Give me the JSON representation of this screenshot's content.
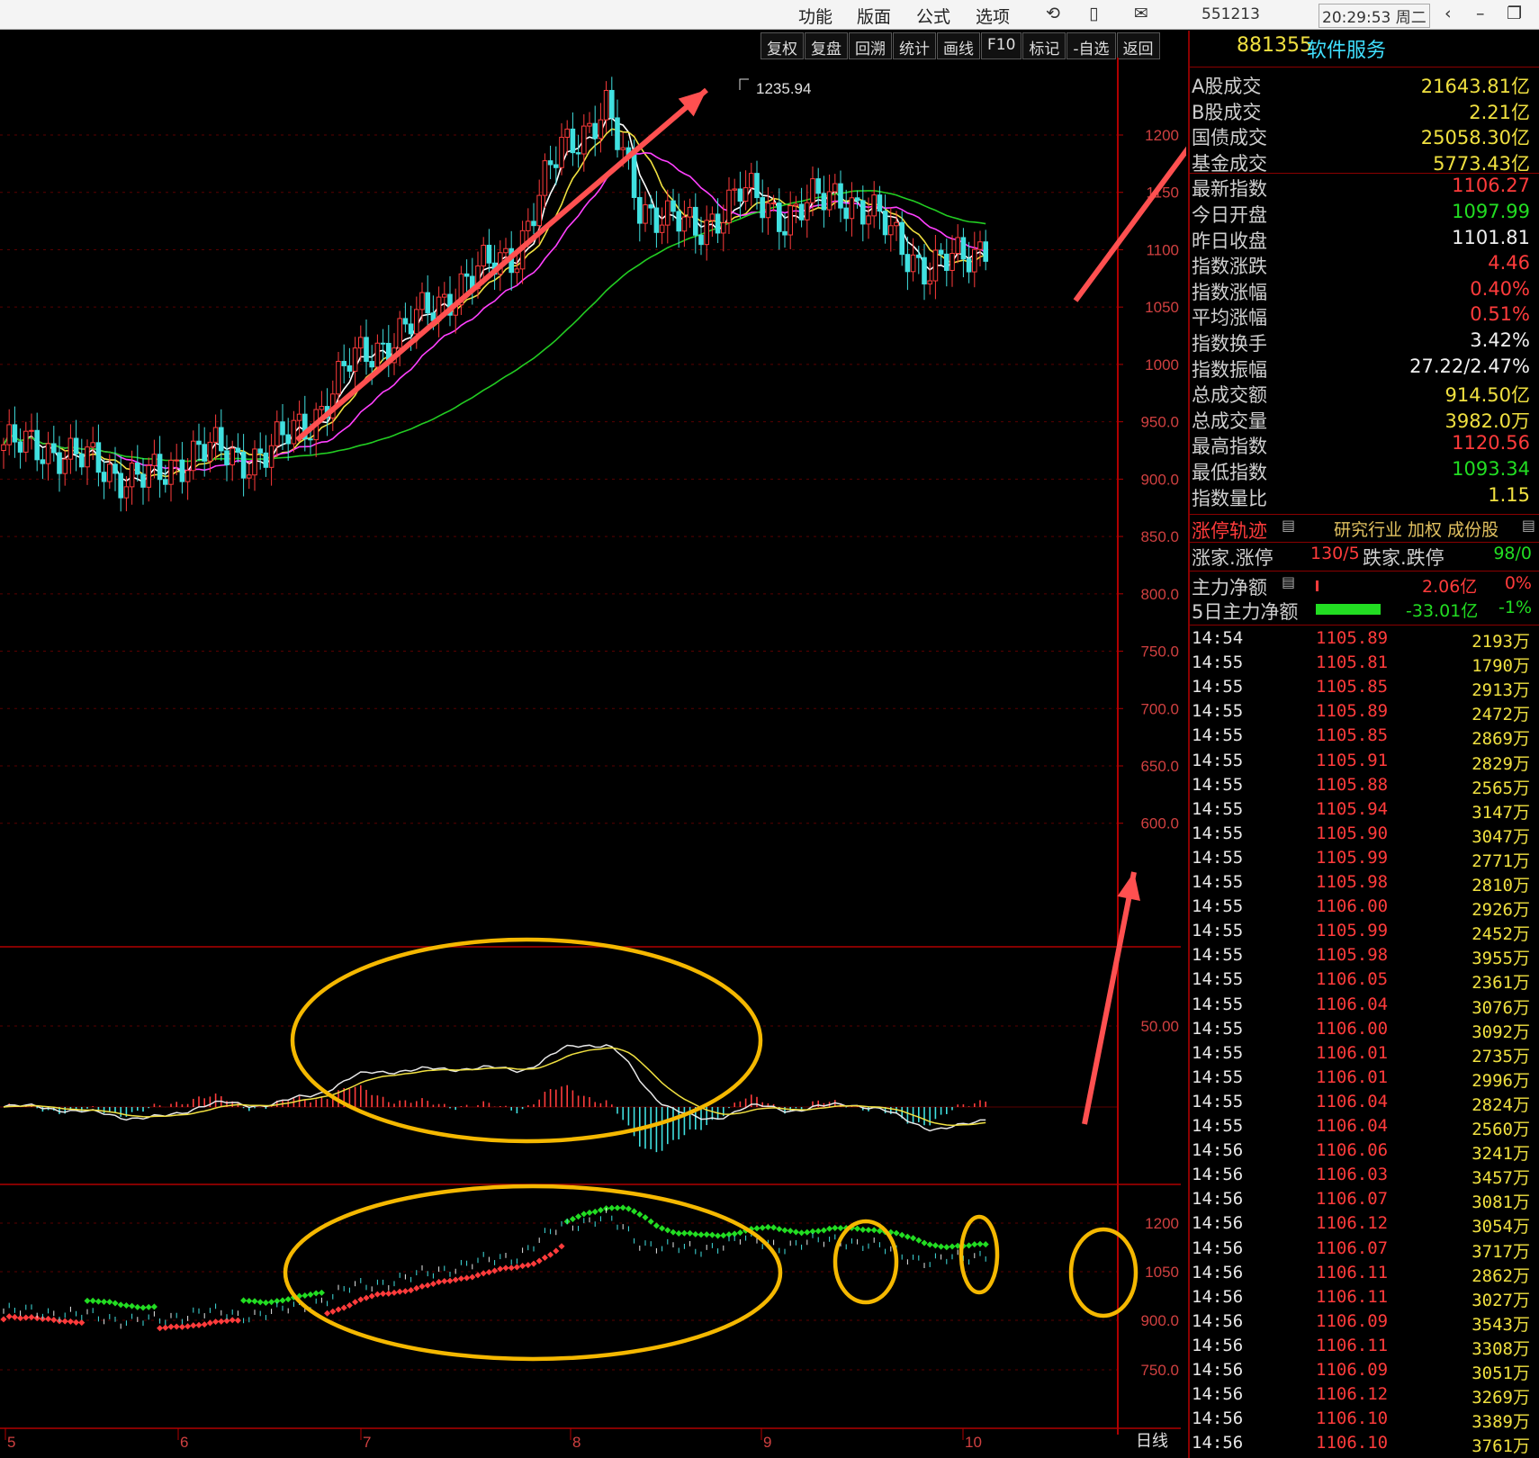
{
  "topbar": {
    "menus": [
      "功能",
      "版面",
      "公式",
      "选项"
    ],
    "code": "551213",
    "clock": "20:29:53 周二"
  },
  "chart_toolbar": [
    "复权",
    "复盘",
    "回溯",
    "统计",
    "画线",
    "F10",
    "标记",
    "-自选",
    "返回"
  ],
  "chart": {
    "peak_label": "1235.94",
    "price_axis": [
      "1200",
      "1150",
      "1100",
      "1050",
      "1000",
      "950.0",
      "900.0",
      "850.0",
      "800.0",
      "750.0",
      "700.0",
      "650.0",
      "600.0"
    ],
    "macd_axis": [
      "50.00"
    ],
    "lower_axis": [
      "1200",
      "1050",
      "900.0",
      "750.0"
    ],
    "x_labels": [
      "5",
      "6",
      "7",
      "8",
      "9",
      "10"
    ],
    "period": "日线",
    "colors": {
      "up": "#ff3b3b",
      "down": "#40e0e0",
      "ma5": "#ffffff",
      "ma10": "#f0e040",
      "ma20": "#ff40ff",
      "ma60": "#22cc22",
      "annot_arrow": "#ff5050",
      "annot_ellipse": "#f5b800"
    }
  },
  "side": {
    "title_code": "881355",
    "title_name": "软件服务",
    "stats": [
      {
        "label": "A股成交",
        "value": "21643.81亿",
        "color": "yellow"
      },
      {
        "label": "B股成交",
        "value": "2.21亿",
        "color": "yellow"
      },
      {
        "label": "国债成交",
        "value": "25058.30亿",
        "color": "yellow"
      },
      {
        "label": "基金成交",
        "value": "5773.43亿",
        "color": "yellow"
      },
      {
        "label": "最新指数",
        "value": "1106.27",
        "color": "red"
      },
      {
        "label": "今日开盘",
        "value": "1097.99",
        "color": "green"
      },
      {
        "label": "昨日收盘",
        "value": "1101.81",
        "color": "white"
      },
      {
        "label": "指数涨跌",
        "value": "4.46",
        "color": "red"
      },
      {
        "label": "指数涨幅",
        "value": "0.40%",
        "color": "red"
      },
      {
        "label": "平均涨幅",
        "value": "0.51%",
        "color": "red"
      },
      {
        "label": "指数换手",
        "value": "3.42%",
        "color": "white"
      },
      {
        "label": "指数振幅",
        "value": "27.22/2.47%",
        "color": "white"
      },
      {
        "label": "总成交额",
        "value": "914.50亿",
        "color": "yellow"
      },
      {
        "label": "总成交量",
        "value": "3982.0万",
        "color": "yellow"
      },
      {
        "label": "最高指数",
        "value": "1120.56",
        "color": "red"
      },
      {
        "label": "最低指数",
        "value": "1093.34",
        "color": "green"
      },
      {
        "label": "指数量比",
        "value": "1.15",
        "color": "yellow"
      }
    ],
    "track_label": "涨停轨迹",
    "track_links": "研究行业 加权 成份股",
    "updown_label": "涨家.涨停",
    "updown_value": "130/5",
    "down_label": "跌家.跌停",
    "down_value": "98/0",
    "net_label": "主力净额",
    "net_value": "2.06亿",
    "net_pct": "0%",
    "net5_label": "5日主力净额",
    "net5_value": "-33.01亿",
    "net5_pct": "-1%",
    "ticks": [
      [
        "14:54",
        "1105.89",
        "2193万"
      ],
      [
        "14:55",
        "1105.81",
        "1790万"
      ],
      [
        "14:55",
        "1105.85",
        "2913万"
      ],
      [
        "14:55",
        "1105.89",
        "2472万"
      ],
      [
        "14:55",
        "1105.85",
        "2869万"
      ],
      [
        "14:55",
        "1105.91",
        "2829万"
      ],
      [
        "14:55",
        "1105.88",
        "2565万"
      ],
      [
        "14:55",
        "1105.94",
        "3147万"
      ],
      [
        "14:55",
        "1105.90",
        "3047万"
      ],
      [
        "14:55",
        "1105.99",
        "2771万"
      ],
      [
        "14:55",
        "1105.98",
        "2810万"
      ],
      [
        "14:55",
        "1106.00",
        "2926万"
      ],
      [
        "14:55",
        "1105.99",
        "2452万"
      ],
      [
        "14:55",
        "1105.98",
        "3955万"
      ],
      [
        "14:55",
        "1106.05",
        "2361万"
      ],
      [
        "14:55",
        "1106.04",
        "3076万"
      ],
      [
        "14:55",
        "1106.00",
        "3092万"
      ],
      [
        "14:55",
        "1106.01",
        "2735万"
      ],
      [
        "14:55",
        "1106.01",
        "2996万"
      ],
      [
        "14:55",
        "1106.04",
        "2824万"
      ],
      [
        "14:55",
        "1106.04",
        "2560万"
      ],
      [
        "14:56",
        "1106.06",
        "3241万"
      ],
      [
        "14:56",
        "1106.03",
        "3457万"
      ],
      [
        "14:56",
        "1106.07",
        "3081万"
      ],
      [
        "14:56",
        "1106.12",
        "3054万"
      ],
      [
        "14:56",
        "1106.07",
        "3717万"
      ],
      [
        "14:56",
        "1106.11",
        "2862万"
      ],
      [
        "14:56",
        "1106.11",
        "3027万"
      ],
      [
        "14:56",
        "1106.09",
        "3543万"
      ],
      [
        "14:56",
        "1106.11",
        "3308万"
      ],
      [
        "14:56",
        "1106.09",
        "3051万"
      ],
      [
        "14:56",
        "1106.12",
        "3269万"
      ],
      [
        "14:56",
        "1106.10",
        "3389万"
      ],
      [
        "14:56",
        "1106.10",
        "3761万"
      ]
    ]
  }
}
